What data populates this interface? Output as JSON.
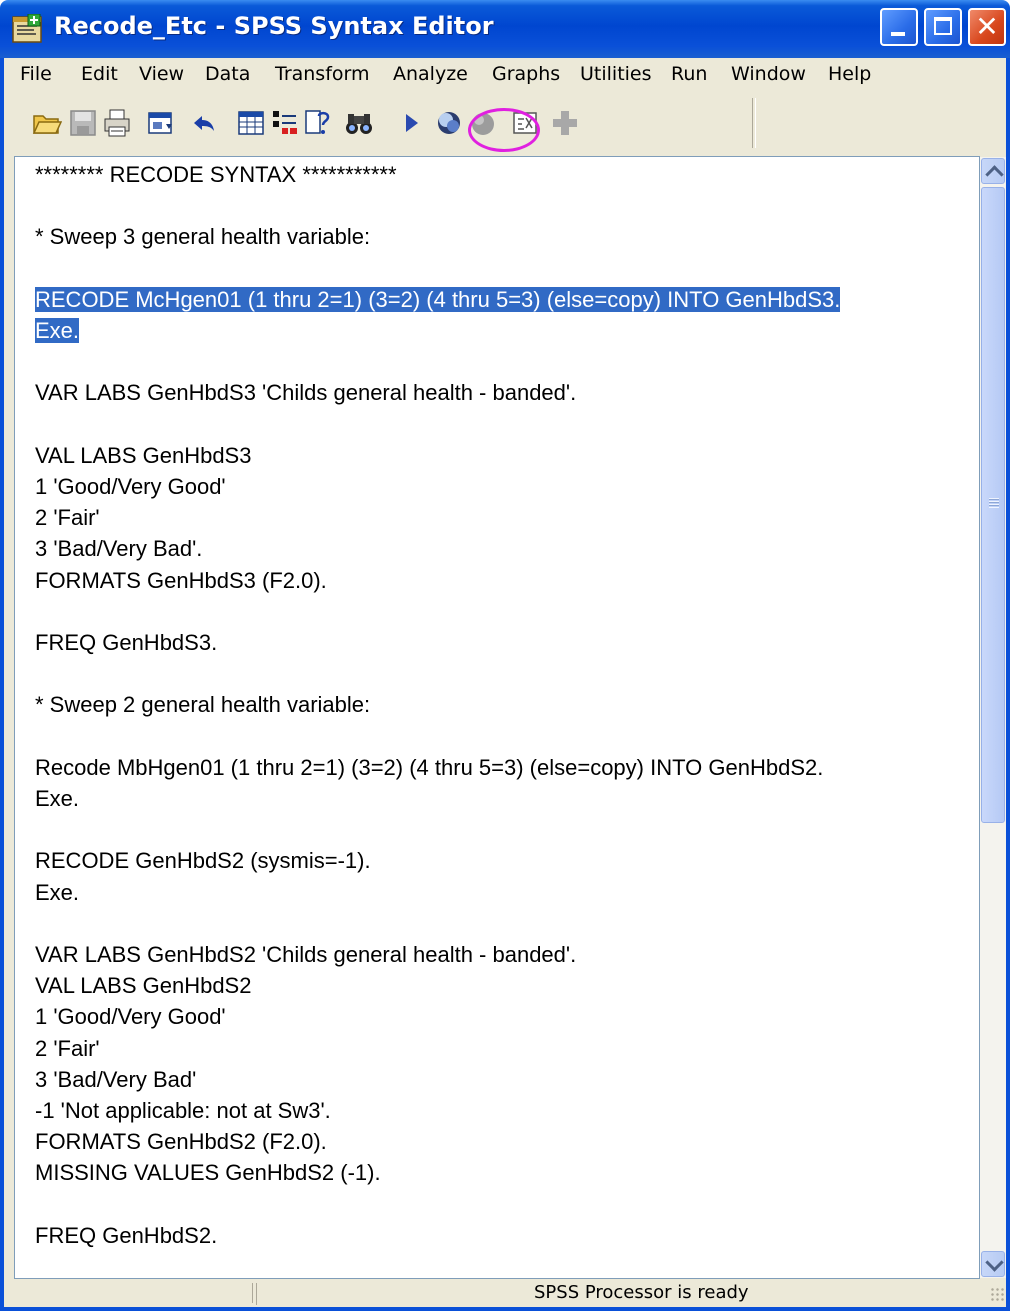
{
  "window": {
    "title": "Recode_Etc - SPSS Syntax Editor",
    "close_glyph": "✕"
  },
  "menu": [
    "File",
    "Edit",
    "View",
    "Data",
    "Transform",
    "Analyze",
    "Graphs",
    "Utilities",
    "Run",
    "Window",
    "Help"
  ],
  "toolbar": {
    "icons": [
      "open-folder-icon",
      "save-icon",
      "print-icon",
      "dialog-recall-icon",
      "undo-icon",
      "goto-data-icon",
      "variables-icon",
      "help-topics-icon",
      "find-icon",
      "run-icon",
      "use-sets-icon",
      "show-all-variables-icon",
      "syntax-help-icon",
      "add-icon"
    ],
    "highlight_color": "#e020e0"
  },
  "editor": {
    "selection_color": "#316ac5",
    "lines": [
      "******** RECODE SYNTAX ***********",
      "",
      "* Sweep 3 general health variable:",
      "",
      "RECODE McHgen01 (1 thru 2=1) (3=2) (4 thru 5=3) (else=copy) INTO GenHbdS3.",
      "Exe.",
      "",
      "VAR LABS GenHbdS3 'Childs general health - banded'.",
      "",
      "VAL LABS GenHbdS3",
      "1 'Good/Very Good'",
      "2 'Fair'",
      "3 'Bad/Very Bad'.",
      "FORMATS GenHbdS3 (F2.0).",
      "",
      "FREQ GenHbdS3.",
      "",
      "* Sweep 2 general health variable:",
      "",
      "Recode MbHgen01 (1 thru 2=1) (3=2) (4 thru 5=3) (else=copy) INTO GenHbdS2.",
      "Exe.",
      "",
      "RECODE GenHbdS2 (sysmis=-1).",
      "Exe.",
      "",
      "VAR LABS GenHbdS2 'Childs general health - banded'.",
      "VAL LABS GenHbdS2",
      "1 'Good/Very Good'",
      "2 'Fair'",
      "3 'Bad/Very Bad'",
      "-1 'Not applicable: not at Sw3'.",
      "FORMATS GenHbdS2 (F2.0).",
      "MISSING VALUES GenHbdS2 (-1).",
      "",
      "FREQ GenHbdS2."
    ],
    "selected_lines": [
      4,
      5
    ]
  },
  "status": {
    "text": "SPSS Processor is ready"
  }
}
